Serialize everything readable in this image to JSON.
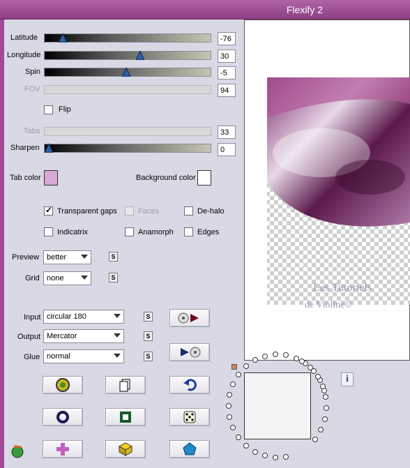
{
  "window": {
    "title": "Flexify 2"
  },
  "sliders": {
    "latitude": {
      "label": "Latitude",
      "value": "-76",
      "fraction": 0.09
    },
    "longitude": {
      "label": "Longitude",
      "value": "30",
      "fraction": 0.58
    },
    "spin": {
      "label": "Spin",
      "value": "-5",
      "fraction": 0.49
    },
    "fov": {
      "label": "FOV",
      "value": "94"
    },
    "tabs": {
      "label": "Tabs",
      "value": "33"
    },
    "sharpen": {
      "label": "Sharpen",
      "value": "0",
      "fraction": 0.0
    }
  },
  "flip": {
    "label": "Flip",
    "checked": false
  },
  "colors": {
    "tab_label": "Tab color",
    "tab_value": "#d7a8d8",
    "bg_label": "Background color",
    "bg_value": "#ffffff",
    "accent": "#9c4594"
  },
  "options": {
    "transparent_gaps": {
      "label": "Transparent gaps",
      "checked": true
    },
    "faces": {
      "label": "Faces",
      "checked": false
    },
    "dehalo": {
      "label": "De-halo",
      "checked": false
    },
    "indicatrix": {
      "label": "Indicatrix",
      "checked": false
    },
    "anamorph": {
      "label": "Anamorph",
      "checked": false
    },
    "edges": {
      "label": "Edges",
      "checked": false
    }
  },
  "preview_quality": {
    "label": "Preview",
    "value": "better"
  },
  "grid": {
    "label": "Grid",
    "value": "none"
  },
  "input": {
    "label": "Input",
    "value": "circular 180"
  },
  "output": {
    "label": "Output",
    "value": "Mercator"
  },
  "glue": {
    "label": "Glue",
    "value": "normal"
  },
  "s_label": "S",
  "info_label": "i",
  "watermark": {
    "line1": "Les Tutoriels",
    "line2": "de Violine©"
  }
}
